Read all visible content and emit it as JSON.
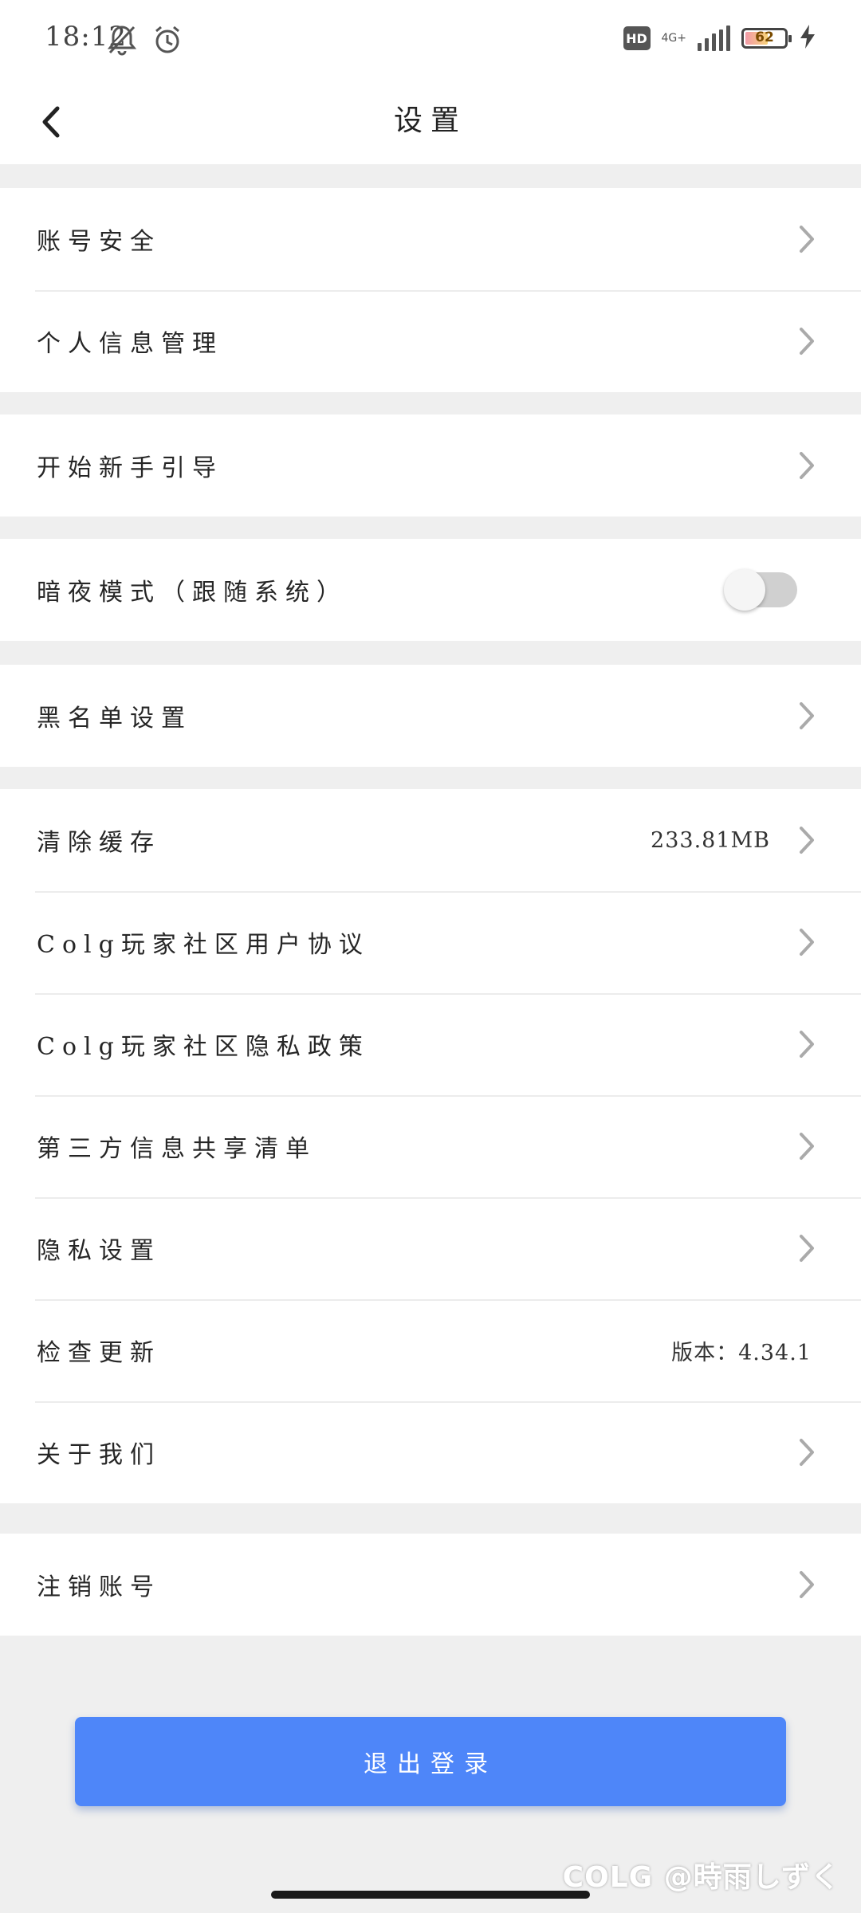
{
  "status_bar": {
    "time": "18:12",
    "hd": "HD",
    "network": "4G+",
    "battery": "62",
    "battery_level": 0.62
  },
  "header": {
    "title": "设置"
  },
  "groups": [
    {
      "items": [
        {
          "label": "账号安全"
        },
        {
          "label": "个人信息管理"
        }
      ]
    },
    {
      "items": [
        {
          "label": "开始新手引导"
        }
      ]
    },
    {
      "items": [
        {
          "label": "暗夜模式（跟随系统）",
          "toggle_on": false
        }
      ]
    },
    {
      "items": [
        {
          "label": "黑名单设置"
        }
      ]
    },
    {
      "items": [
        {
          "label": "清除缓存",
          "value": "233.81MB"
        },
        {
          "label": "Colg玩家社区用户协议"
        },
        {
          "label": "Colg玩家社区隐私政策"
        },
        {
          "label": "第三方信息共享清单"
        },
        {
          "label": "隐私设置"
        },
        {
          "label": "检查更新",
          "value": "版本：4.34.1"
        },
        {
          "label": "关于我们"
        }
      ]
    },
    {
      "items": [
        {
          "label": "注销账号"
        }
      ]
    }
  ],
  "logout_label": "退出登录",
  "watermark": "COLG @時雨しずく"
}
